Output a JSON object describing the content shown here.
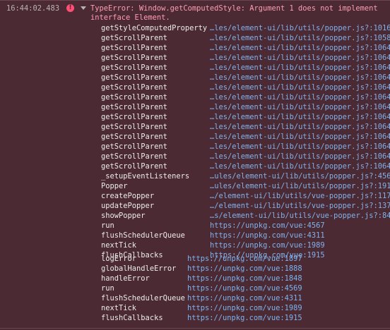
{
  "message": {
    "timestamp": "16:44:02.483",
    "error_line_1": "TypeError: Window.getComputedStyle: Argument 1 does not implement",
    "error_line_2": "interface Element.",
    "icons": {
      "error": "error-circle-icon",
      "toggle": "triangle-down-icon"
    },
    "colors": {
      "background": "#4b2a33",
      "error_text": "#ff9db5",
      "link": "#7fb2ee",
      "error_icon": "#ff4f74"
    }
  },
  "stack_1": [
    {
      "fn": "getStyleComputedProperty",
      "loc": "…les/element-ui/lib/utils/popper.js?:1016"
    },
    {
      "fn": "getScrollParent",
      "loc": "…les/element-ui/lib/utils/popper.js?:1058"
    },
    {
      "fn": "getScrollParent",
      "loc": "…les/element-ui/lib/utils/popper.js?:1064"
    },
    {
      "fn": "getScrollParent",
      "loc": "…les/element-ui/lib/utils/popper.js?:1064"
    },
    {
      "fn": "getScrollParent",
      "loc": "…les/element-ui/lib/utils/popper.js?:1064"
    },
    {
      "fn": "getScrollParent",
      "loc": "…les/element-ui/lib/utils/popper.js?:1064"
    },
    {
      "fn": "getScrollParent",
      "loc": "…les/element-ui/lib/utils/popper.js?:1064"
    },
    {
      "fn": "getScrollParent",
      "loc": "…les/element-ui/lib/utils/popper.js?:1064"
    },
    {
      "fn": "getScrollParent",
      "loc": "…les/element-ui/lib/utils/popper.js?:1064"
    },
    {
      "fn": "getScrollParent",
      "loc": "…les/element-ui/lib/utils/popper.js?:1064"
    },
    {
      "fn": "getScrollParent",
      "loc": "…les/element-ui/lib/utils/popper.js?:1064"
    },
    {
      "fn": "getScrollParent",
      "loc": "…les/element-ui/lib/utils/popper.js?:1064"
    },
    {
      "fn": "getScrollParent",
      "loc": "…les/element-ui/lib/utils/popper.js?:1064"
    },
    {
      "fn": "getScrollParent",
      "loc": "…les/element-ui/lib/utils/popper.js?:1064"
    },
    {
      "fn": "getScrollParent",
      "loc": "…les/element-ui/lib/utils/popper.js?:1064"
    },
    {
      "fn": "_setupEventListeners",
      "loc": "…ules/element-ui/lib/utils/popper.js?:456"
    },
    {
      "fn": "Popper",
      "loc": "…ules/element-ui/lib/utils/popper.js?:191"
    },
    {
      "fn": "createPopper",
      "loc": "…/element-ui/lib/utils/vue-popper.js?:117"
    },
    {
      "fn": "updatePopper",
      "loc": "…/element-ui/lib/utils/vue-popper.js?:137"
    },
    {
      "fn": "showPopper",
      "loc": "…s/element-ui/lib/utils/vue-popper.js?:84"
    },
    {
      "fn": "run",
      "loc": "https://unpkg.com/vue:4567"
    },
    {
      "fn": "flushSchedulerQueue",
      "loc": "https://unpkg.com/vue:4311"
    },
    {
      "fn": "nextTick",
      "loc": "https://unpkg.com/vue:1989"
    },
    {
      "fn": "flushCallbacks",
      "loc": "https://unpkg.com/vue:1915"
    }
  ],
  "stack_2": [
    {
      "fn": "logError",
      "loc": "https://unpkg.com/vue:1897"
    },
    {
      "fn": "globalHandleError",
      "loc": "https://unpkg.com/vue:1888"
    },
    {
      "fn": "handleError",
      "loc": "https://unpkg.com/vue:1848"
    },
    {
      "fn": "run",
      "loc": "https://unpkg.com/vue:4569"
    },
    {
      "fn": "flushSchedulerQueue",
      "loc": "https://unpkg.com/vue:4311"
    },
    {
      "fn": "nextTick",
      "loc": "https://unpkg.com/vue:1989"
    },
    {
      "fn": "flushCallbacks",
      "loc": "https://unpkg.com/vue:1915"
    }
  ]
}
